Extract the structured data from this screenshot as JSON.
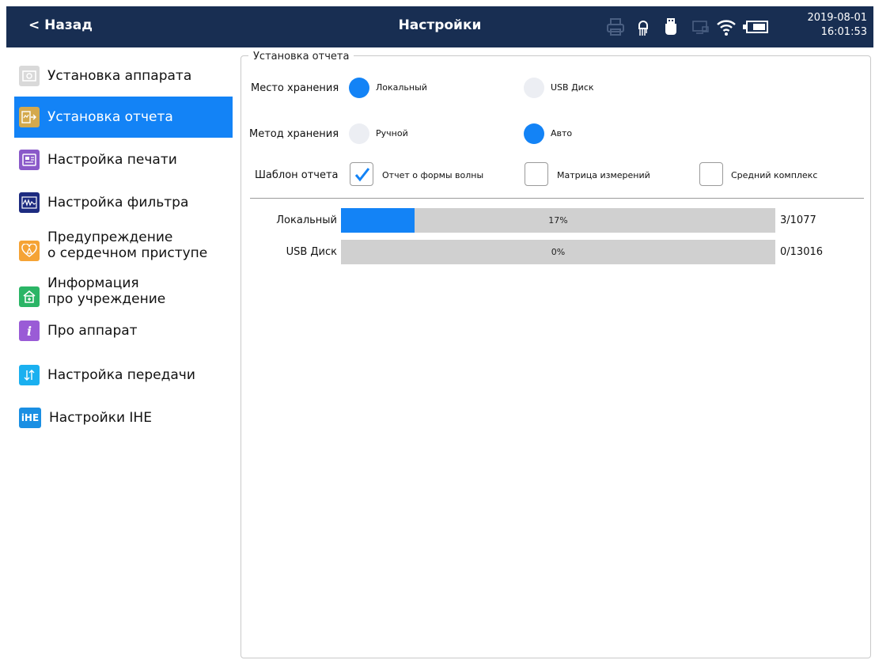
{
  "header": {
    "back_label": "< Назад",
    "title": "Настройки",
    "date": "2019-08-01",
    "time": "16:01:53",
    "status_icons": [
      "printer-icon",
      "ecg-lead-icon",
      "usb-icon",
      "network-icon",
      "wifi-icon",
      "battery-icon"
    ],
    "bg_color": "#182e52"
  },
  "sidebar": {
    "accent_color": "#1383f6",
    "items": [
      {
        "label": "Установка аппарата",
        "icon": "device-icon",
        "icon_color": "#d9d9d9",
        "active": false
      },
      {
        "label": "Установка отчета",
        "icon": "report-icon",
        "icon_color": "#d4a94d",
        "active": true
      },
      {
        "label": "Настройка печати",
        "icon": "print-settings-icon",
        "icon_color": "#8a59c9",
        "active": false
      },
      {
        "label": "Настройка фильтра",
        "icon": "filter-icon",
        "icon_color": "#1d2b80",
        "active": false
      },
      {
        "label": "Предупреждение",
        "label2": "о сердечном приступе",
        "icon": "heart-warning-icon",
        "icon_color": "#f5a335",
        "active": false
      },
      {
        "label": "Информация",
        "label2": "про учреждение",
        "icon": "institution-icon",
        "icon_color": "#2bb566",
        "active": false
      },
      {
        "label": "Про аппарат",
        "icon": "info-icon",
        "icon_color": "#9a5bd6",
        "active": false
      },
      {
        "label": "Настройка передачи",
        "icon": "transfer-icon",
        "icon_color": "#1ab0f0",
        "active": false
      },
      {
        "label": "Настройки IHE",
        "icon": "ihe-icon",
        "icon_color": "#1a8fe3",
        "icon_text": "iHE",
        "active": false
      }
    ]
  },
  "report": {
    "legend": "Установка отчета",
    "storage_place": {
      "label": "Место хранения",
      "options": [
        {
          "label": "Локальный",
          "selected": true
        },
        {
          "label": "USB Диск",
          "selected": false
        }
      ]
    },
    "storage_method": {
      "label": "Метод хранения",
      "options": [
        {
          "label": "Ручной",
          "selected": false
        },
        {
          "label": "Авто",
          "selected": true
        }
      ]
    },
    "template": {
      "label": "Шаблон отчета",
      "options": [
        {
          "label": "Отчет о формы волны",
          "checked": true
        },
        {
          "label": "Матрица измерений",
          "checked": false
        },
        {
          "label": "Средний комплекс",
          "checked": false
        }
      ]
    },
    "storage_usage": [
      {
        "label": "Локальный",
        "percent_text": "17%",
        "fraction": 0.17,
        "count": "3/1077"
      },
      {
        "label": "USB Диск",
        "percent_text": "0%",
        "fraction": 0.0,
        "count": "0/13016"
      }
    ]
  }
}
